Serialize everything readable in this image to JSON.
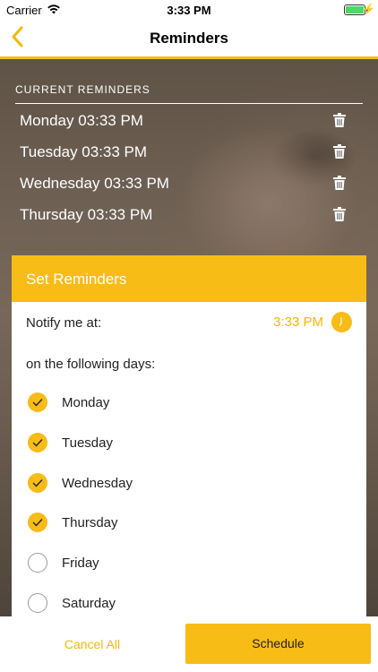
{
  "status_bar": {
    "carrier": "Carrier",
    "time": "3:33 PM",
    "wifi_icon": "wifi-icon",
    "battery_icon": "battery-full-icon",
    "charging_icon": "bolt-icon"
  },
  "nav": {
    "back_icon": "chevron-left-icon",
    "back_glyph": "‹",
    "title": "Reminders"
  },
  "colors": {
    "accent": "#f8bc16",
    "accent_text": "#f5b800",
    "background": "#ffffff"
  },
  "current_reminders": {
    "header": "CURRENT REMINDERS",
    "delete_icon": "trash-icon",
    "items": [
      {
        "label": "Monday 03:33 PM"
      },
      {
        "label": "Tuesday 03:33 PM"
      },
      {
        "label": "Wednesday 03:33 PM"
      },
      {
        "label": "Thursday 03:33 PM"
      }
    ]
  },
  "set_reminders": {
    "title": "Set Reminders",
    "notify_label": "Notify me at:",
    "notify_time": "3:33 PM",
    "clock_icon": "clock-icon",
    "days_label": "on the following days:",
    "days": [
      {
        "label": "Monday",
        "checked": true
      },
      {
        "label": "Tuesday",
        "checked": true
      },
      {
        "label": "Wednesday",
        "checked": true
      },
      {
        "label": "Thursday",
        "checked": true
      },
      {
        "label": "Friday",
        "checked": false
      },
      {
        "label": "Saturday",
        "checked": false
      }
    ]
  },
  "actions": {
    "cancel_all": "Cancel All",
    "schedule": "Schedule"
  }
}
